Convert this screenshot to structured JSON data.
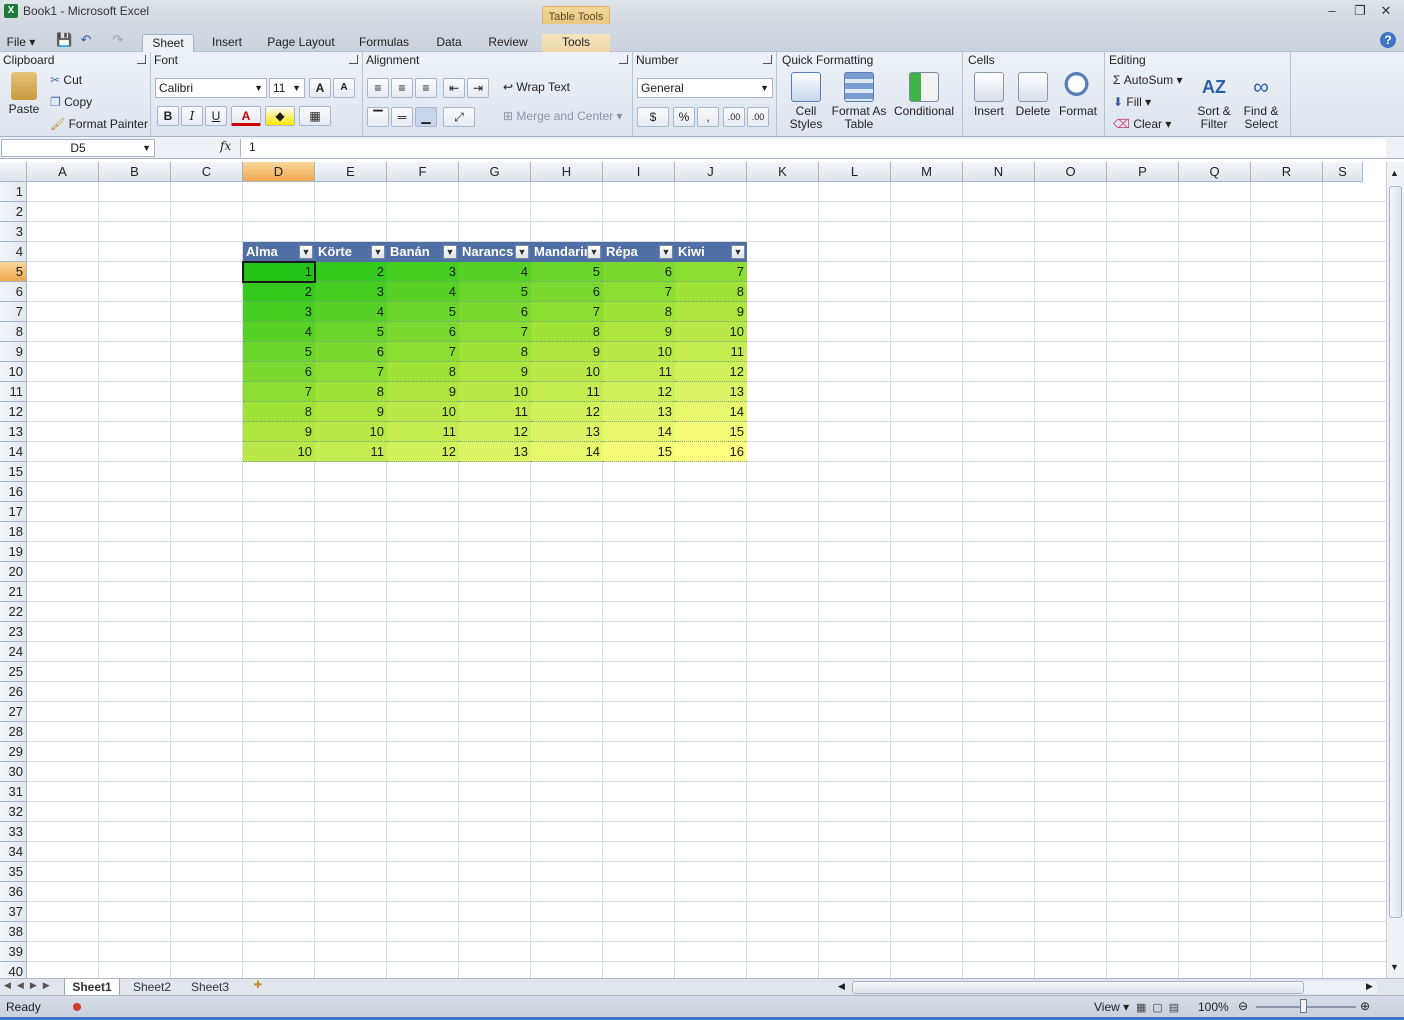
{
  "window": {
    "title": "Book1 - Microsoft Excel",
    "context_tab_group": "Table Tools",
    "minimize": "–",
    "restore": "❐",
    "close": "✕"
  },
  "tabs": {
    "file": "File ▾",
    "sheet": "Sheet",
    "insert": "Insert",
    "page_layout": "Page Layout",
    "formulas": "Formulas",
    "data": "Data",
    "review": "Review",
    "tools": "Tools",
    "help": "?"
  },
  "ribbon": {
    "clipboard": {
      "title": "Clipboard",
      "paste": "Paste",
      "cut": "Cut",
      "copy": "Copy",
      "format_painter": "Format Painter"
    },
    "font": {
      "title": "Font",
      "font_name": "Calibri",
      "font_size": "11",
      "bold": "B",
      "italic": "I",
      "underline": "U",
      "grow": "A",
      "shrink": "A"
    },
    "alignment": {
      "title": "Alignment",
      "wrap_text": "Wrap Text",
      "merge_center": "Merge and Center"
    },
    "number": {
      "title": "Number",
      "format": "General",
      "percent": "%",
      "comma": ",",
      "inc_decimal": ".00",
      "dec_decimal": ".00"
    },
    "quick_formatting": {
      "title": "Quick Formatting",
      "cell_styles_1": "Cell",
      "cell_styles_2": "Styles",
      "format_table_1": "Format As",
      "format_table_2": "Table",
      "conditional": "Conditional"
    },
    "cells": {
      "title": "Cells",
      "insert": "Insert",
      "delete": "Delete",
      "format": "Format"
    },
    "editing": {
      "title": "Editing",
      "autosum": "AutoSum",
      "fill": "Fill",
      "clear": "Clear",
      "sort_1": "Sort &",
      "sort_2": "Filter",
      "find_1": "Find &",
      "find_2": "Select"
    }
  },
  "formula_bar": {
    "name_box": "D5",
    "fx": "fx",
    "content": "1"
  },
  "columns": [
    "A",
    "B",
    "C",
    "D",
    "E",
    "F",
    "G",
    "H",
    "I",
    "J",
    "K",
    "L",
    "M",
    "N",
    "O",
    "P",
    "Q",
    "R",
    "S"
  ],
  "selected_column": "D",
  "rows": [
    "1",
    "2",
    "3",
    "4",
    "5",
    "6",
    "7",
    "8",
    "9",
    "10",
    "11",
    "12",
    "13",
    "14",
    "15",
    "16",
    "17",
    "18",
    "19",
    "20",
    "21",
    "22",
    "23",
    "24",
    "25",
    "26",
    "27",
    "28",
    "29",
    "30",
    "31",
    "32",
    "33",
    "34",
    "35",
    "36",
    "37",
    "38",
    "39",
    "40"
  ],
  "selected_row": "5",
  "table": {
    "headers": [
      "Alma",
      "Körte",
      "Banán",
      "Narancs",
      "Mandarin",
      "Répa",
      "Kiwi"
    ],
    "rows": [
      [
        "1",
        "2",
        "3",
        "4",
        "5",
        "6",
        "7"
      ],
      [
        "2",
        "3",
        "4",
        "5",
        "6",
        "7",
        "8"
      ],
      [
        "3",
        "4",
        "5",
        "6",
        "7",
        "8",
        "9"
      ],
      [
        "4",
        "5",
        "6",
        "7",
        "8",
        "9",
        "10"
      ],
      [
        "5",
        "6",
        "7",
        "8",
        "9",
        "10",
        "11"
      ],
      [
        "6",
        "7",
        "8",
        "9",
        "10",
        "11",
        "12"
      ],
      [
        "7",
        "8",
        "9",
        "10",
        "11",
        "12",
        "13"
      ],
      [
        "8",
        "9",
        "10",
        "11",
        "12",
        "13",
        "14"
      ],
      [
        "9",
        "10",
        "11",
        "12",
        "13",
        "14",
        "15"
      ],
      [
        "10",
        "11",
        "12",
        "13",
        "14",
        "15",
        "16"
      ]
    ],
    "scale_colors": {
      "low": "#23c418",
      "mid": "#a8e43a",
      "high": "#ffff80"
    },
    "header_color": "#4f6fa5"
  },
  "sheets": [
    "Sheet1",
    "Sheet2",
    "Sheet3"
  ],
  "active_sheet": "Sheet1",
  "status": {
    "text": "Ready",
    "view": "View ▾",
    "zoom": "100%"
  }
}
